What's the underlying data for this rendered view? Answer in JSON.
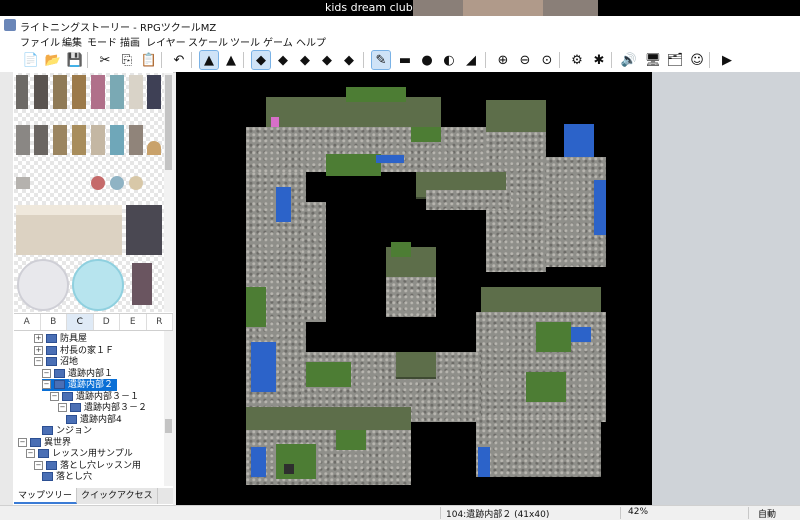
{
  "overlay": {
    "label": "kids dream club"
  },
  "window": {
    "title": "ライトニングストーリー - RPGツクールMZ"
  },
  "menu": [
    "ファイル",
    "編集",
    "モード",
    "描画",
    "レイヤー",
    "スケール",
    "ツール",
    "ゲーム",
    "ヘルプ"
  ],
  "toolbar": [
    {
      "name": "new-project-icon",
      "glyph": "📄"
    },
    {
      "name": "open-project-icon",
      "glyph": "📂"
    },
    {
      "name": "save-project-icon",
      "glyph": "💾"
    },
    {
      "name": "cut-icon",
      "glyph": "✂"
    },
    {
      "name": "copy-icon",
      "glyph": "⎘"
    },
    {
      "name": "paste-icon",
      "glyph": "📋"
    },
    {
      "name": "undo-icon",
      "glyph": "↶"
    },
    {
      "name": "map-mode-icon",
      "glyph": "▲"
    },
    {
      "name": "event-mode-icon",
      "glyph": "▲"
    },
    {
      "name": "layer-1-icon",
      "glyph": "◆"
    },
    {
      "name": "layer-2-icon",
      "glyph": "◆"
    },
    {
      "name": "layer-3-icon",
      "glyph": "◆"
    },
    {
      "name": "layer-4-icon",
      "glyph": "◆"
    },
    {
      "name": "layer-auto-icon",
      "glyph": "◆"
    },
    {
      "name": "pencil-icon",
      "glyph": "✎"
    },
    {
      "name": "rectangle-icon",
      "glyph": "▬"
    },
    {
      "name": "ellipse-icon",
      "glyph": "●"
    },
    {
      "name": "fill-icon",
      "glyph": "◐"
    },
    {
      "name": "shadow-pen-icon",
      "glyph": "◢"
    },
    {
      "name": "zoom-in-icon",
      "glyph": "⊕"
    },
    {
      "name": "zoom-out-icon",
      "glyph": "⊖"
    },
    {
      "name": "zoom-actual-icon",
      "glyph": "⊙"
    },
    {
      "name": "database-icon",
      "glyph": "⚙"
    },
    {
      "name": "plugin-manager-icon",
      "glyph": "✱"
    },
    {
      "name": "sound-test-icon",
      "glyph": "🔊"
    },
    {
      "name": "event-searcher-icon",
      "glyph": "🖥"
    },
    {
      "name": "resource-manager-icon",
      "glyph": "🗂"
    },
    {
      "name": "character-generator-icon",
      "glyph": "☺"
    },
    {
      "name": "playtest-icon",
      "glyph": "▶"
    }
  ],
  "tileset_tabs": [
    "A",
    "B",
    "C",
    "D",
    "E",
    "R"
  ],
  "selected_tileset_tab": "C",
  "map_tree": [
    {
      "label": "防具屋",
      "indent": 2,
      "expander": "+"
    },
    {
      "label": "村長の家１Ｆ",
      "indent": 2,
      "expander": "+"
    },
    {
      "label": "沼地",
      "indent": 2,
      "expander": "−"
    },
    {
      "label": "遺跡内部１",
      "indent": 3,
      "expander": "−"
    },
    {
      "label": "遺跡内部２",
      "indent": 3,
      "expander": "−",
      "selected": true
    },
    {
      "label": "遺跡内部３－１",
      "indent": 4,
      "expander": "−"
    },
    {
      "label": "遺跡内部３－２",
      "indent": 5,
      "expander": "−"
    },
    {
      "label": "遺跡内部4",
      "indent": 6,
      "expander": ""
    },
    {
      "label": "ンジョン",
      "indent": 3,
      "expander": ""
    },
    {
      "label": "異世界",
      "indent": 0,
      "expander": "−"
    },
    {
      "label": "レッスン用サンプル",
      "indent": 1,
      "expander": "−"
    },
    {
      "label": "落とし穴レッスン用",
      "indent": 2,
      "expander": "−"
    },
    {
      "label": "落とし穴",
      "indent": 3,
      "expander": ""
    }
  ],
  "bottom_tabs": [
    "マップツリー",
    "クイックアクセス"
  ],
  "status": {
    "map_info": "104:遺跡内部２ (41x40)",
    "zoom": "42%",
    "mode": "自動"
  }
}
